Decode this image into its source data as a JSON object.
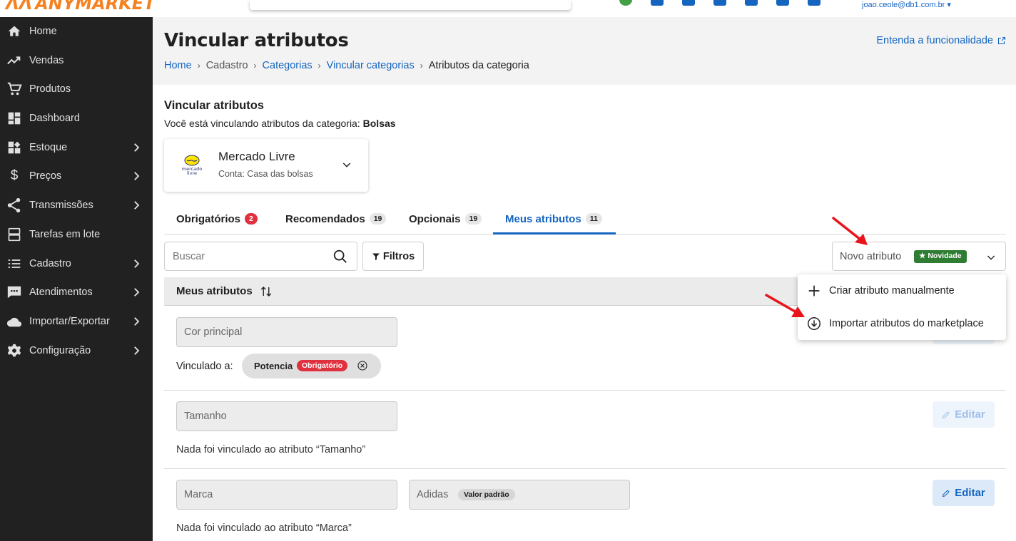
{
  "brand": {
    "logo_text": "ANYMARKET"
  },
  "user": {
    "email": "joao.ceole@db1.com.br ▾"
  },
  "sidebar": {
    "items": [
      {
        "label": "Home",
        "icon": "home-icon",
        "has_children": false
      },
      {
        "label": "Vendas",
        "icon": "trending-up-icon",
        "has_children": false
      },
      {
        "label": "Produtos",
        "icon": "cart-icon",
        "has_children": false
      },
      {
        "label": "Dashboard",
        "icon": "dashboard-icon",
        "has_children": false
      },
      {
        "label": "Estoque",
        "icon": "stock-icon",
        "has_children": true
      },
      {
        "label": "Preços",
        "icon": "dollar-icon",
        "has_children": true
      },
      {
        "label": "Transmissões",
        "icon": "share-icon",
        "has_children": true
      },
      {
        "label": "Tarefas em lote",
        "icon": "batch-icon",
        "has_children": false
      },
      {
        "label": "Cadastro",
        "icon": "list-icon",
        "has_children": true
      },
      {
        "label": "Atendimentos",
        "icon": "chat-icon",
        "has_children": true
      },
      {
        "label": "Importar/Exportar",
        "icon": "cloud-icon",
        "has_children": true
      },
      {
        "label": "Configuração",
        "icon": "gear-icon",
        "has_children": true
      }
    ]
  },
  "header": {
    "title": "Vincular atributos",
    "help_link": "Entenda a funcionalidade",
    "breadcrumb": [
      {
        "label": "Home",
        "link": true
      },
      {
        "label": "Cadastro",
        "link": false
      },
      {
        "label": "Categorias",
        "link": true
      },
      {
        "label": "Vincular categorias",
        "link": true
      },
      {
        "label": "Atributos da categoria",
        "link": false
      }
    ]
  },
  "section": {
    "title": "Vincular atributos",
    "subtitle_prefix": "Você está vinculando atributos da categoria: ",
    "category": "Bolsas"
  },
  "marketplace": {
    "name": "Mercado Livre",
    "account": "Conta: Casa das bolsas",
    "logo_text_1": "mercado",
    "logo_text_2": "livre"
  },
  "tabs": [
    {
      "label": "Obrigatórios",
      "count": "2",
      "active": false
    },
    {
      "label": "Recomendados",
      "count": "19",
      "active": false
    },
    {
      "label": "Opcionais",
      "count": "19",
      "active": false
    },
    {
      "label": "Meus atributos",
      "count": "11",
      "active": true
    }
  ],
  "search": {
    "placeholder": "Buscar"
  },
  "filters_label": "Filtros",
  "new_attribute": {
    "label": "Novo atributo",
    "badge": "★ Novidade"
  },
  "dropdown": {
    "items": [
      {
        "label": "Criar atributo manualmente",
        "icon": "plus-icon"
      },
      {
        "label": "Importar atributos do marketplace",
        "icon": "download-circle-icon"
      }
    ]
  },
  "list": {
    "header": "Meus atributos",
    "rows": [
      {
        "name": "Cor principal",
        "linked_label": "Vinculado a:",
        "linked_name": "Potencia",
        "linked_badge": "Obrigatório"
      },
      {
        "name": "Tamanho",
        "nothing_text": "Nada foi vinculado ao atributo “Tamanho”",
        "edit_label": "Editar"
      },
      {
        "name": "Marca",
        "default_value": "Adidas",
        "default_badge": "Valor padrão",
        "nothing_text": "Nada foi vinculado ao atributo “Marca”",
        "edit_label": "Editar"
      }
    ]
  },
  "colors": {
    "primary": "#1565c0",
    "sidebar_bg": "#212121",
    "danger": "#e0323e",
    "success": "#2e7d32",
    "annotation_arrow": "#e8141c"
  }
}
